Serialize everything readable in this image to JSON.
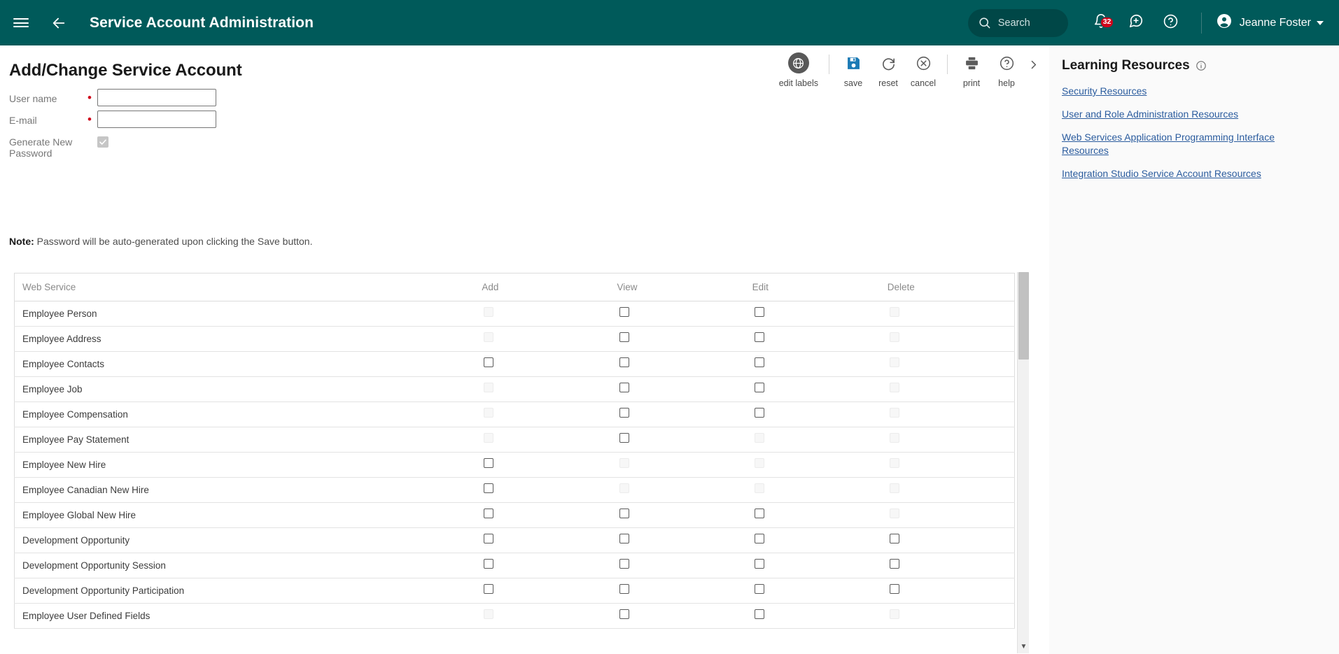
{
  "appbar": {
    "menu_icon": "hamburger-menu-icon",
    "back_icon": "back-arrow-icon",
    "title": "Service Account Administration",
    "search": {
      "label": "Search",
      "icon": "search-icon"
    },
    "notifications": {
      "icon": "bell-icon",
      "badge": "32"
    },
    "feedback": {
      "icon": "feedback-chat-icon"
    },
    "help": {
      "icon": "help-question-icon"
    },
    "user": {
      "avatar_icon": "user-avatar-icon",
      "name": "Jeanne Foster",
      "caret_icon": "chevron-down-icon"
    }
  },
  "page": {
    "title": "Add/Change Service Account",
    "note_prefix": "Note:",
    "note_text": " Password will be auto-generated upon clicking the Save button."
  },
  "toolbar": {
    "items": [
      {
        "label": "edit labels",
        "icon": "globe-icon"
      },
      {
        "label": "save",
        "icon": "save-disk-icon"
      },
      {
        "label": "reset",
        "icon": "reset-refresh-icon"
      },
      {
        "label": "cancel",
        "icon": "cancel-x-circle-icon"
      },
      {
        "label": "print",
        "icon": "printer-icon"
      },
      {
        "label": "help",
        "icon": "help-question-circle-icon"
      }
    ],
    "more_icon": "chevron-right-icon"
  },
  "form": {
    "fields": [
      {
        "label": "User name",
        "required": true,
        "value": "",
        "placeholder": ""
      },
      {
        "label": "E-mail",
        "required": true,
        "value": "",
        "placeholder": ""
      }
    ],
    "generate_password": {
      "label": "Generate New Password",
      "checked": true,
      "disabled": true
    }
  },
  "table": {
    "columns": [
      "Web Service",
      "Add",
      "View",
      "Edit",
      "Delete"
    ],
    "rows": [
      {
        "name": "Employee Person",
        "add": "off",
        "view": "on",
        "edit": "on",
        "delete": "off"
      },
      {
        "name": "Employee Address",
        "add": "off",
        "view": "on",
        "edit": "on",
        "delete": "off"
      },
      {
        "name": "Employee Contacts",
        "add": "on",
        "view": "on",
        "edit": "on",
        "delete": "off"
      },
      {
        "name": "Employee Job",
        "add": "off",
        "view": "on",
        "edit": "on",
        "delete": "off"
      },
      {
        "name": "Employee Compensation",
        "add": "off",
        "view": "on",
        "edit": "on",
        "delete": "off"
      },
      {
        "name": "Employee Pay Statement",
        "add": "off",
        "view": "on",
        "edit": "off",
        "delete": "off"
      },
      {
        "name": "Employee New Hire",
        "add": "on",
        "view": "off",
        "edit": "off",
        "delete": "off"
      },
      {
        "name": "Employee Canadian New Hire",
        "add": "on",
        "view": "off",
        "edit": "off",
        "delete": "off"
      },
      {
        "name": "Employee Global New Hire",
        "add": "on",
        "view": "on",
        "edit": "on",
        "delete": "off"
      },
      {
        "name": "Development Opportunity",
        "add": "on",
        "view": "on",
        "edit": "on",
        "delete": "on"
      },
      {
        "name": "Development Opportunity Session",
        "add": "on",
        "view": "on",
        "edit": "on",
        "delete": "on"
      },
      {
        "name": "Development Opportunity Participation",
        "add": "on",
        "view": "on",
        "edit": "on",
        "delete": "on"
      },
      {
        "name": "Employee User Defined Fields",
        "add": "off",
        "view": "on",
        "edit": "on",
        "delete": "off"
      }
    ],
    "scroll_down_icon": "scroll-down-arrow-icon"
  },
  "learning": {
    "title": "Learning Resources",
    "info_icon": "info-circle-icon",
    "links": [
      "Security Resources",
      "User and Role Administration Resources",
      "Web Services Application Programming Interface Resources",
      "Integration Studio Service Account Resources"
    ]
  },
  "colors": {
    "appbar_bg": "#005a5a",
    "badge_red": "#d0021b",
    "save_blue": "#1b7ab5",
    "link_blue": "#2b5c9e",
    "required_red": "#d0021b"
  }
}
